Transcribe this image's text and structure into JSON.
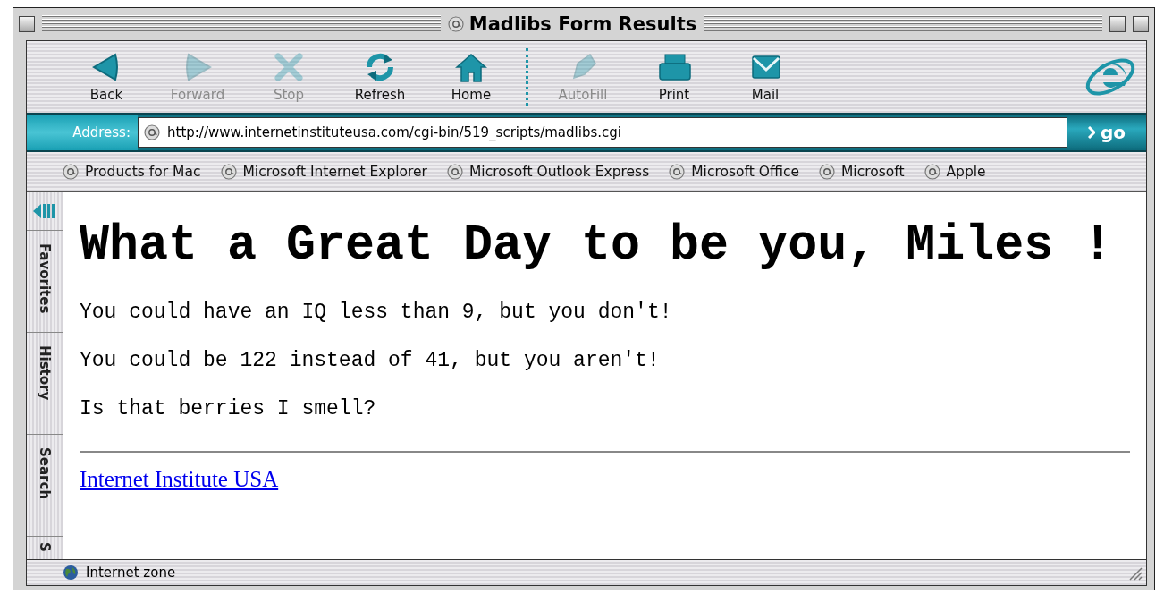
{
  "window": {
    "title": "Madlibs Form Results"
  },
  "toolbar": {
    "navigation": [
      {
        "kind": "back",
        "label": "Back",
        "disabled": false
      },
      {
        "kind": "forward",
        "label": "Forward",
        "disabled": true
      },
      {
        "kind": "stop",
        "label": "Stop",
        "disabled": true
      },
      {
        "kind": "refresh",
        "label": "Refresh",
        "disabled": false
      },
      {
        "kind": "home",
        "label": "Home",
        "disabled": false
      }
    ],
    "tools": [
      {
        "kind": "autofill",
        "label": "AutoFill",
        "disabled": true
      },
      {
        "kind": "print",
        "label": "Print",
        "disabled": false
      },
      {
        "kind": "mail",
        "label": "Mail",
        "disabled": false
      }
    ]
  },
  "address_bar": {
    "label": "Address:",
    "url": "http://www.internetinstituteusa.com/cgi-bin/519_scripts/madlibs.cgi",
    "go_button": "go"
  },
  "favorites": [
    "Products for Mac",
    "Microsoft Internet Explorer",
    "Microsoft Outlook Express",
    "Microsoft Office",
    "Microsoft",
    "Apple"
  ],
  "side_tabs": [
    "Favorites",
    "History",
    "Search",
    "S"
  ],
  "page": {
    "heading": "What a Great Day to be you, Miles !",
    "paragraphs": [
      "You could have an IQ less than 9, but you don't!",
      "You could be 122 instead of 41, but you aren't!",
      "Is that berries I smell?"
    ],
    "link": "Internet Institute USA"
  },
  "status_bar": {
    "text": "Internet zone"
  }
}
